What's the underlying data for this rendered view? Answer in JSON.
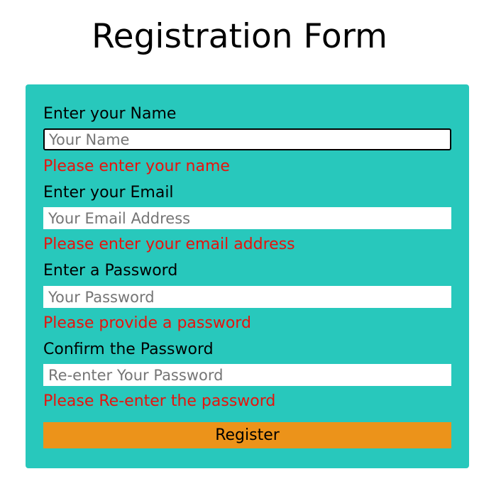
{
  "page": {
    "title": "Registration Form"
  },
  "form": {
    "name": {
      "label": "Enter your Name",
      "placeholder": "Your Name",
      "value": "",
      "error": "Please enter your name"
    },
    "email": {
      "label": "Enter your Email",
      "placeholder": "Your Email Address",
      "value": "",
      "error": "Please enter your email address"
    },
    "password": {
      "label": "Enter a Password",
      "placeholder": "Your Password",
      "value": "",
      "error": "Please provide a password"
    },
    "confirm_password": {
      "label": "Confirm the Password",
      "placeholder": "Re-enter Your Password",
      "value": "",
      "error": "Please Re-enter the password"
    },
    "register_label": "Register"
  },
  "colors": {
    "panel_background": "#28c8bc",
    "error_text": "#e8120c",
    "register_button": "#ec931a"
  }
}
